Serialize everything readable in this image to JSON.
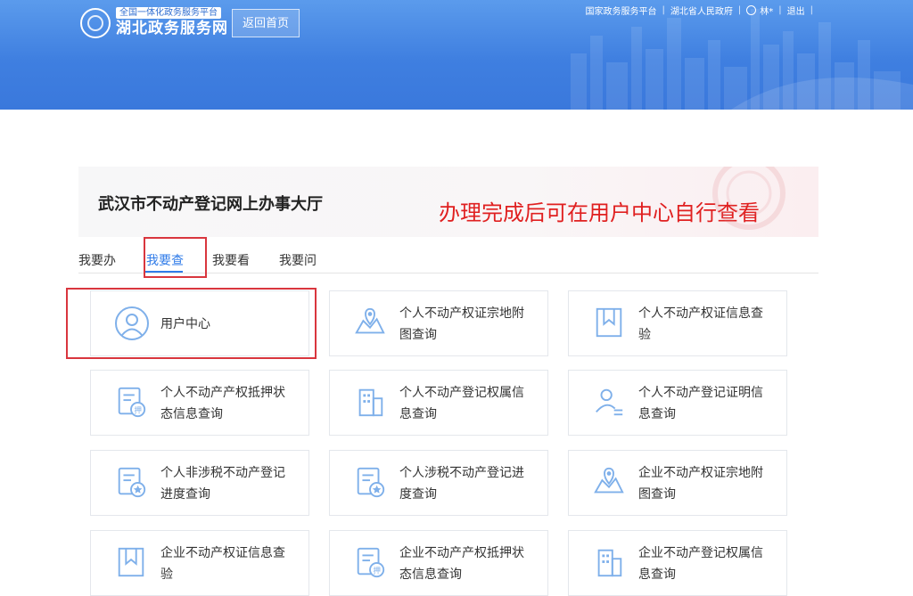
{
  "header": {
    "logo_sub": "全国一体化政务服务平台",
    "logo_main": "湖北政务服务网",
    "home_button": "返回首页",
    "links": [
      "国家政务服务平台",
      "湖北省人民政府"
    ],
    "user_name": "林*",
    "logout": "退出"
  },
  "banner": {
    "title": "武汉市不动产登记网上办事大厅",
    "note": "办理完成后可在用户中心自行查看"
  },
  "tabs": [
    "我要办",
    "我要查",
    "我要看",
    "我要问"
  ],
  "active_tab": "我要查",
  "cards": [
    {
      "label": "用户中心",
      "icon": "user-circle-icon"
    },
    {
      "label": "个人不动产权证宗地附图查询",
      "icon": "map-pin-icon"
    },
    {
      "label": "个人不动产权证信息查验",
      "icon": "bookmark-doc-icon"
    },
    {
      "label": "个人不动产产权抵押状态信息查询",
      "icon": "mortgage-doc-icon"
    },
    {
      "label": "个人不动产登记权属信息查询",
      "icon": "building-icon"
    },
    {
      "label": "个人不动产登记证明信息查询",
      "icon": "person-list-icon"
    },
    {
      "label": "个人非涉税不动产登记进度查询",
      "icon": "progress-doc-icon"
    },
    {
      "label": "个人涉税不动产登记进度查询",
      "icon": "progress-doc-icon"
    },
    {
      "label": "企业不动产权证宗地附图查询",
      "icon": "map-pin-icon"
    },
    {
      "label": "企业不动产权证信息查验",
      "icon": "bookmark-doc-icon"
    },
    {
      "label": "企业不动产产权抵押状态信息查询",
      "icon": "mortgage-doc-icon"
    },
    {
      "label": "企业不动产登记权属信息查询",
      "icon": "building-icon"
    }
  ],
  "card_lines": [
    [
      "用户中心"
    ],
    [
      "个人不动产权证宗地附",
      "图查询"
    ],
    [
      "个人不动产权证信息查",
      "验"
    ],
    [
      "个人不动产产权抵押状",
      "态信息查询"
    ],
    [
      "个人不动产登记权属信",
      "息查询"
    ],
    [
      "个人不动产登记证明信",
      "息查询"
    ],
    [
      "个人非涉税不动产登记",
      "进度查询"
    ],
    [
      "个人涉税不动产登记进",
      "度查询"
    ],
    [
      "企业不动产权证宗地附",
      "图查询"
    ],
    [
      "企业不动产权证信息查",
      "验"
    ],
    [
      "企业不动产产权抵押状",
      "态信息查询"
    ],
    [
      "企业不动产登记权属信",
      "息查询"
    ]
  ],
  "colors": {
    "header_blue": "#3f7fe0",
    "accent": "#2f7be8",
    "annotation_red": "#e02020",
    "highlight_box": "#d9363e",
    "icon_blue": "#7fb0ea"
  }
}
